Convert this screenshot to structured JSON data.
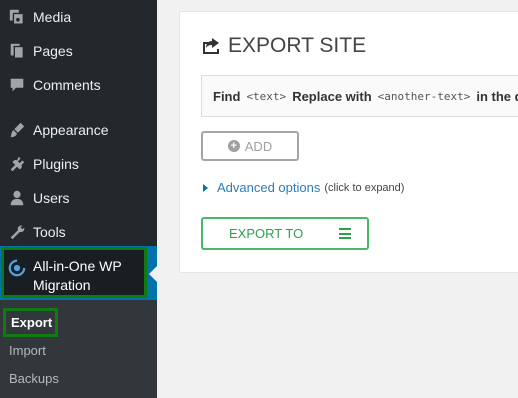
{
  "sidebar": {
    "items": [
      {
        "label": "Media",
        "icon": "media-icon"
      },
      {
        "label": "Pages",
        "icon": "pages-icon"
      },
      {
        "label": "Comments",
        "icon": "comments-icon"
      },
      {
        "label": "Appearance",
        "icon": "appearance-icon"
      },
      {
        "label": "Plugins",
        "icon": "plugins-icon"
      },
      {
        "label": "Users",
        "icon": "users-icon"
      },
      {
        "label": "Tools",
        "icon": "tools-icon"
      }
    ],
    "active": {
      "label_line1": "All-in-One WP",
      "label_line2": "Migration",
      "icon": "migration-icon"
    },
    "submenu": {
      "export": "Export",
      "import": "Import",
      "backups": "Backups"
    }
  },
  "panel": {
    "title": "EXPORT SITE",
    "find_row": {
      "find": "Find",
      "text_token": "<text>",
      "replace_with": "Replace with",
      "another_token": "<another-text>",
      "tail": "in the datab"
    },
    "add_label": "ADD",
    "advanced_link": "Advanced options",
    "advanced_hint": "(click to expand)",
    "export_label": "EXPORT TO"
  },
  "colors": {
    "sidebar_bg": "#23282d",
    "highlight_border": "#127a12",
    "link": "#2e7cb6",
    "export_green": "#4ab866"
  }
}
